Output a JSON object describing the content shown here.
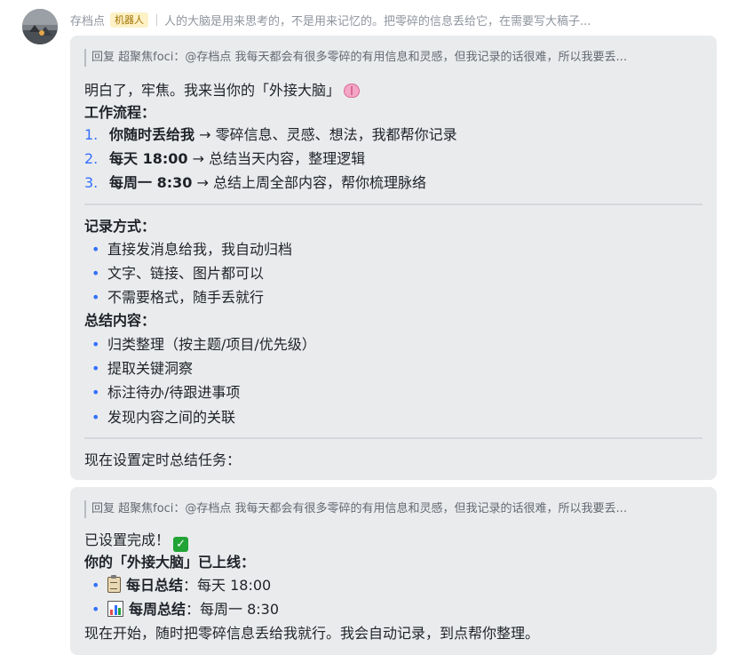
{
  "message_header": {
    "sender": "存档点",
    "badge": "机器人",
    "preview": "人的大脑是用来思考的，不是用来记忆的。把零碎的信息丢给它，在需要写大稿子..."
  },
  "bubble1": {
    "reply_quote": "回复 超聚焦foci：@存档点 我每天都会有很多零碎的有用信息和灵感，但我记录的话很难，所以我要丢...",
    "intro": "明白了，牢焦。我来当你的「外接大脑」",
    "intro_icon": "brain-icon",
    "workflow_title": "工作流程：",
    "workflow": [
      {
        "num": "1.",
        "bold": "你随时丢给我",
        "rest": " → 零碎信息、灵感、想法，我都帮你记录"
      },
      {
        "num": "2.",
        "bold": "每天 18:00",
        "rest": " → 总结当天内容，整理逻辑"
      },
      {
        "num": "3.",
        "bold": "每周一 8:30",
        "rest": " → 总结上周全部内容，帮你梳理脉络"
      }
    ],
    "record_title": "记录方式：",
    "record_items": [
      "直接发消息给我，我自动归档",
      "文字、链接、图片都可以",
      "不需要格式，随手丢就行"
    ],
    "bullet": "•",
    "summary_title": "总结内容：",
    "summary_items": [
      "归类整理（按主题/项目/优先级）",
      "提取关键洞察",
      "标注待办/待跟进事项",
      "发现内容之间的关联"
    ],
    "footer": "现在设置定时总结任务："
  },
  "bubble2": {
    "reply_quote": "回复 超聚焦foci：@存档点 我每天都会有很多零碎的有用信息和灵感，但我记录的话很难，所以我要丢...",
    "done": "已设置完成！",
    "done_icon": "check-icon",
    "online_title": "你的「外接大脑」已上线：",
    "schedules": [
      {
        "icon": "clipboard-icon",
        "bold": "每日总结",
        "rest": "：每天 18:00"
      },
      {
        "icon": "bar-chart-icon",
        "bold": "每周总结",
        "rest": "：每周一 8:30"
      }
    ],
    "closing": "现在开始，随时把零碎信息丢给我就行。我会自动记录，到点帮你整理。"
  },
  "colors": {
    "bubble_bg": "#eaebed",
    "accent_blue": "#3370ff",
    "badge_bg": "#fdf1c6",
    "badge_text": "#a27300"
  }
}
